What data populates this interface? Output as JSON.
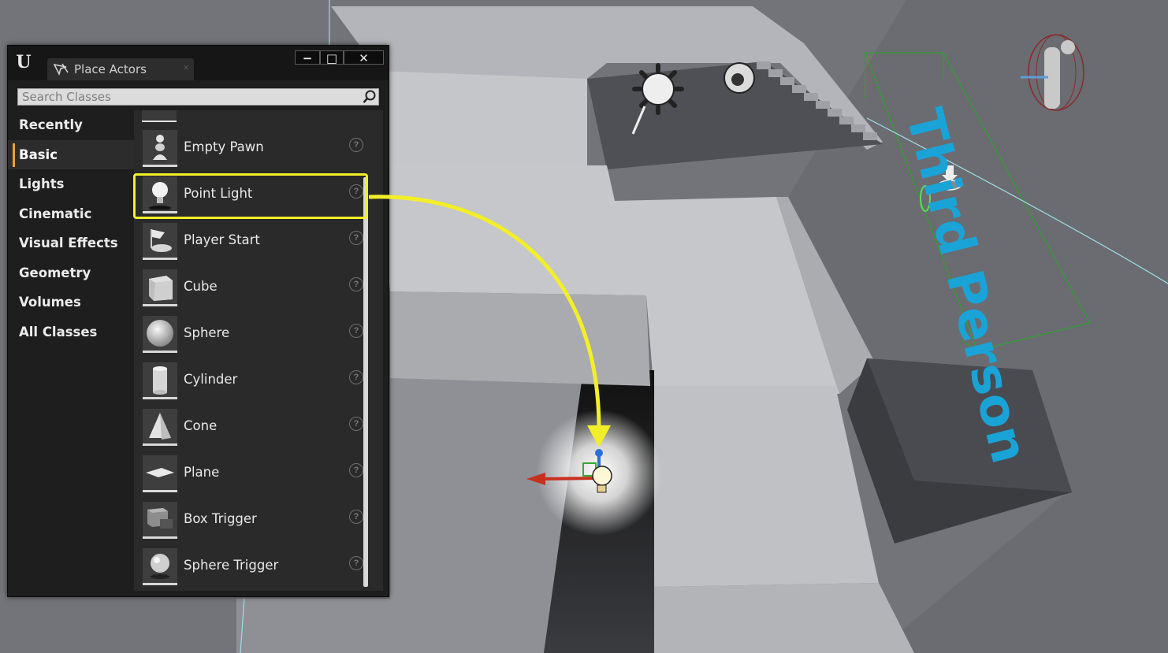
{
  "panel": {
    "logo": "U",
    "tab_title": "Place Actors",
    "tab_close": "×",
    "window_buttons": {
      "minimize": "−",
      "maximize": "□",
      "close": "✕"
    },
    "search": {
      "placeholder": "Search Classes",
      "value": ""
    },
    "categories": [
      {
        "label": "Recently Placed",
        "active": false
      },
      {
        "label": "Basic",
        "active": true
      },
      {
        "label": "Lights",
        "active": false
      },
      {
        "label": "Cinematic",
        "active": false
      },
      {
        "label": "Visual Effects",
        "active": false
      },
      {
        "label": "Geometry",
        "active": false
      },
      {
        "label": "Volumes",
        "active": false
      },
      {
        "label": "All Classes",
        "active": false
      }
    ],
    "items": [
      {
        "label": "Empty Pawn",
        "icon": "pawn-icon"
      },
      {
        "label": "Point Light",
        "icon": "lightbulb-icon",
        "highlighted": true
      },
      {
        "label": "Player Start",
        "icon": "player-start-icon"
      },
      {
        "label": "Cube",
        "icon": "cube-icon"
      },
      {
        "label": "Sphere",
        "icon": "sphere-icon"
      },
      {
        "label": "Cylinder",
        "icon": "cylinder-icon"
      },
      {
        "label": "Cone",
        "icon": "cone-icon"
      },
      {
        "label": "Plane",
        "icon": "plane-icon"
      },
      {
        "label": "Box Trigger",
        "icon": "box-trigger-icon"
      },
      {
        "label": "Sphere Trigger",
        "icon": "sphere-trigger-icon"
      }
    ],
    "help_glyph": "?"
  },
  "viewport": {
    "floor_text": "Third Person",
    "highlight_color": "#f2ef28",
    "accent_color": "#f0a12e",
    "text_decal_color": "#1aa3d6"
  }
}
